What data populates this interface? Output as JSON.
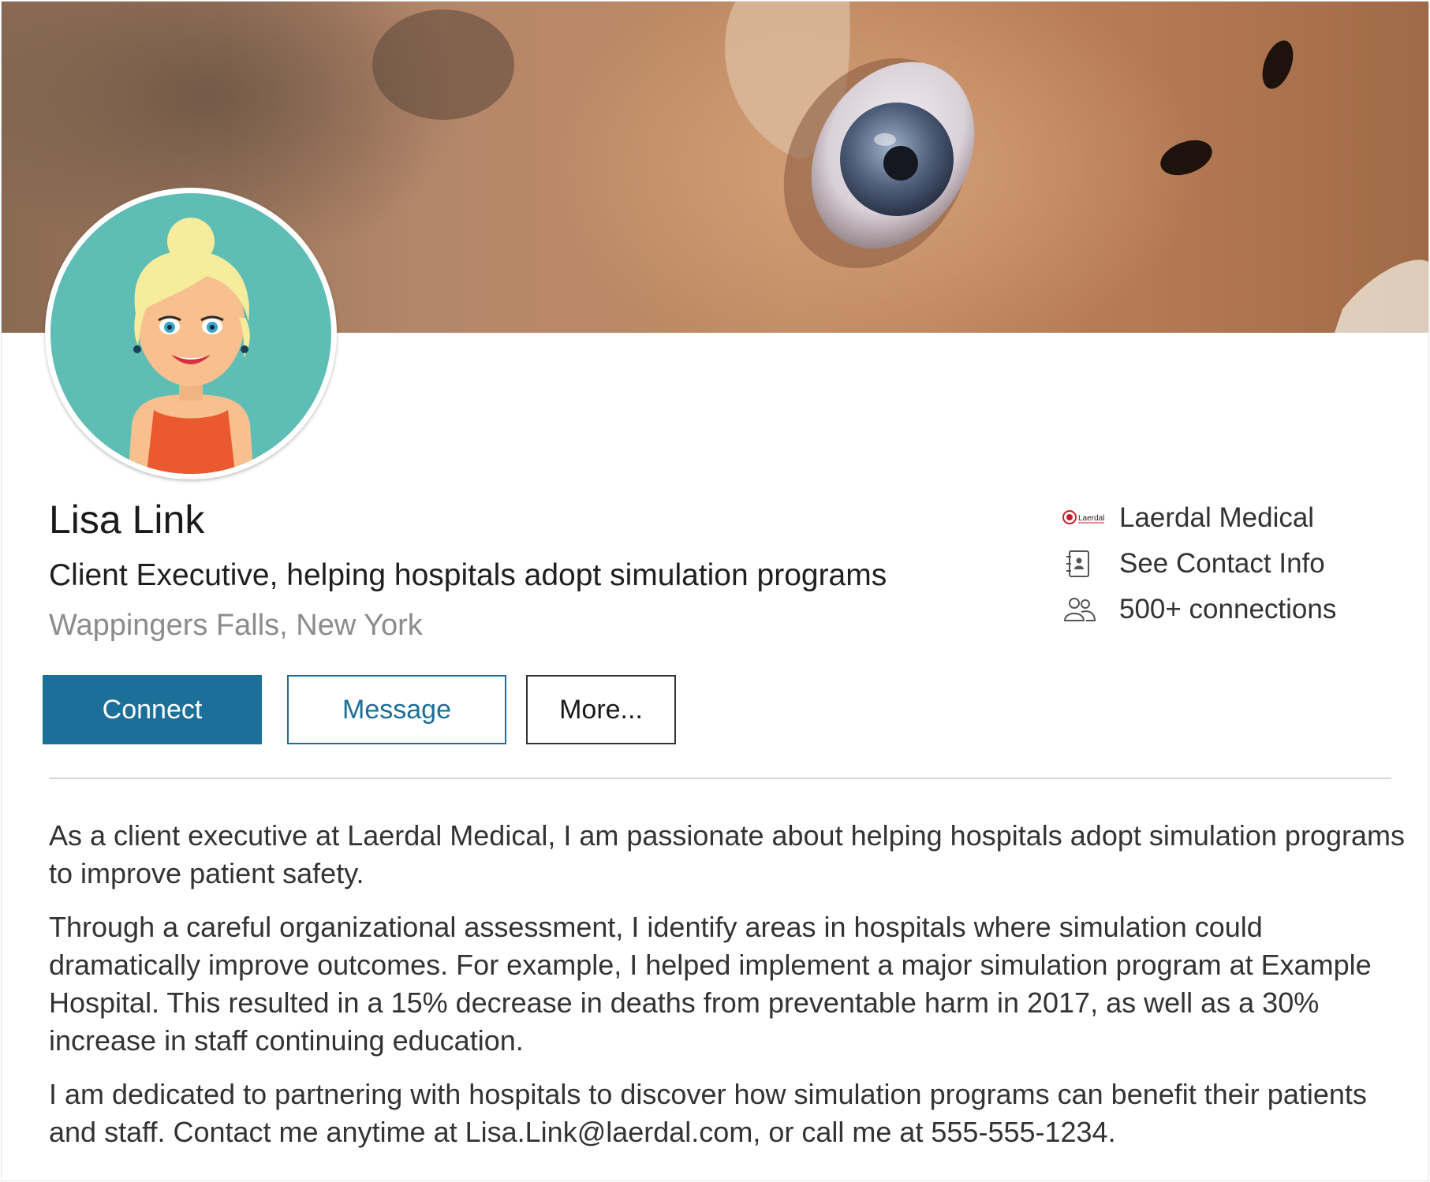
{
  "profile": {
    "name": "Lisa Link",
    "headline": "Client Executive, helping hospitals adopt simulation programs",
    "location": "Wappingers Falls, New York"
  },
  "actions": {
    "connect_label": "Connect",
    "message_label": "Message",
    "more_label": "More..."
  },
  "side_info": {
    "company": "Laerdal Medical",
    "company_logo_text": "Laerdal",
    "contact": "See Contact Info",
    "connections": "500+ connections",
    "icons": {
      "company": "laerdal-logo",
      "contact": "contact-book-icon",
      "connections": "people-icon"
    }
  },
  "about": {
    "paragraphs": [
      "As a client executive at Laerdal Medical, I am passionate about helping hospitals adopt simulation programs to improve patient safety.",
      "Through a careful organizational assessment, I identify areas in hospitals where simulation could dramatically improve outcomes. For example, I helped implement a major simulation program at Example Hospital. This resulted in a 15% decrease in deaths from preventable harm in 2017, as well as a 30% increase in staff continuing education.",
      "I am dedicated to partnering with hospitals to discover how simulation programs can benefit their patients and staff. Contact me anytime at Lisa.Link@laerdal.com, or call me at 555-555-1234."
    ]
  },
  "colors": {
    "primary": "#1b6f98",
    "avatar_background": "#5ebdb5",
    "divider": "#d9d9d9"
  }
}
